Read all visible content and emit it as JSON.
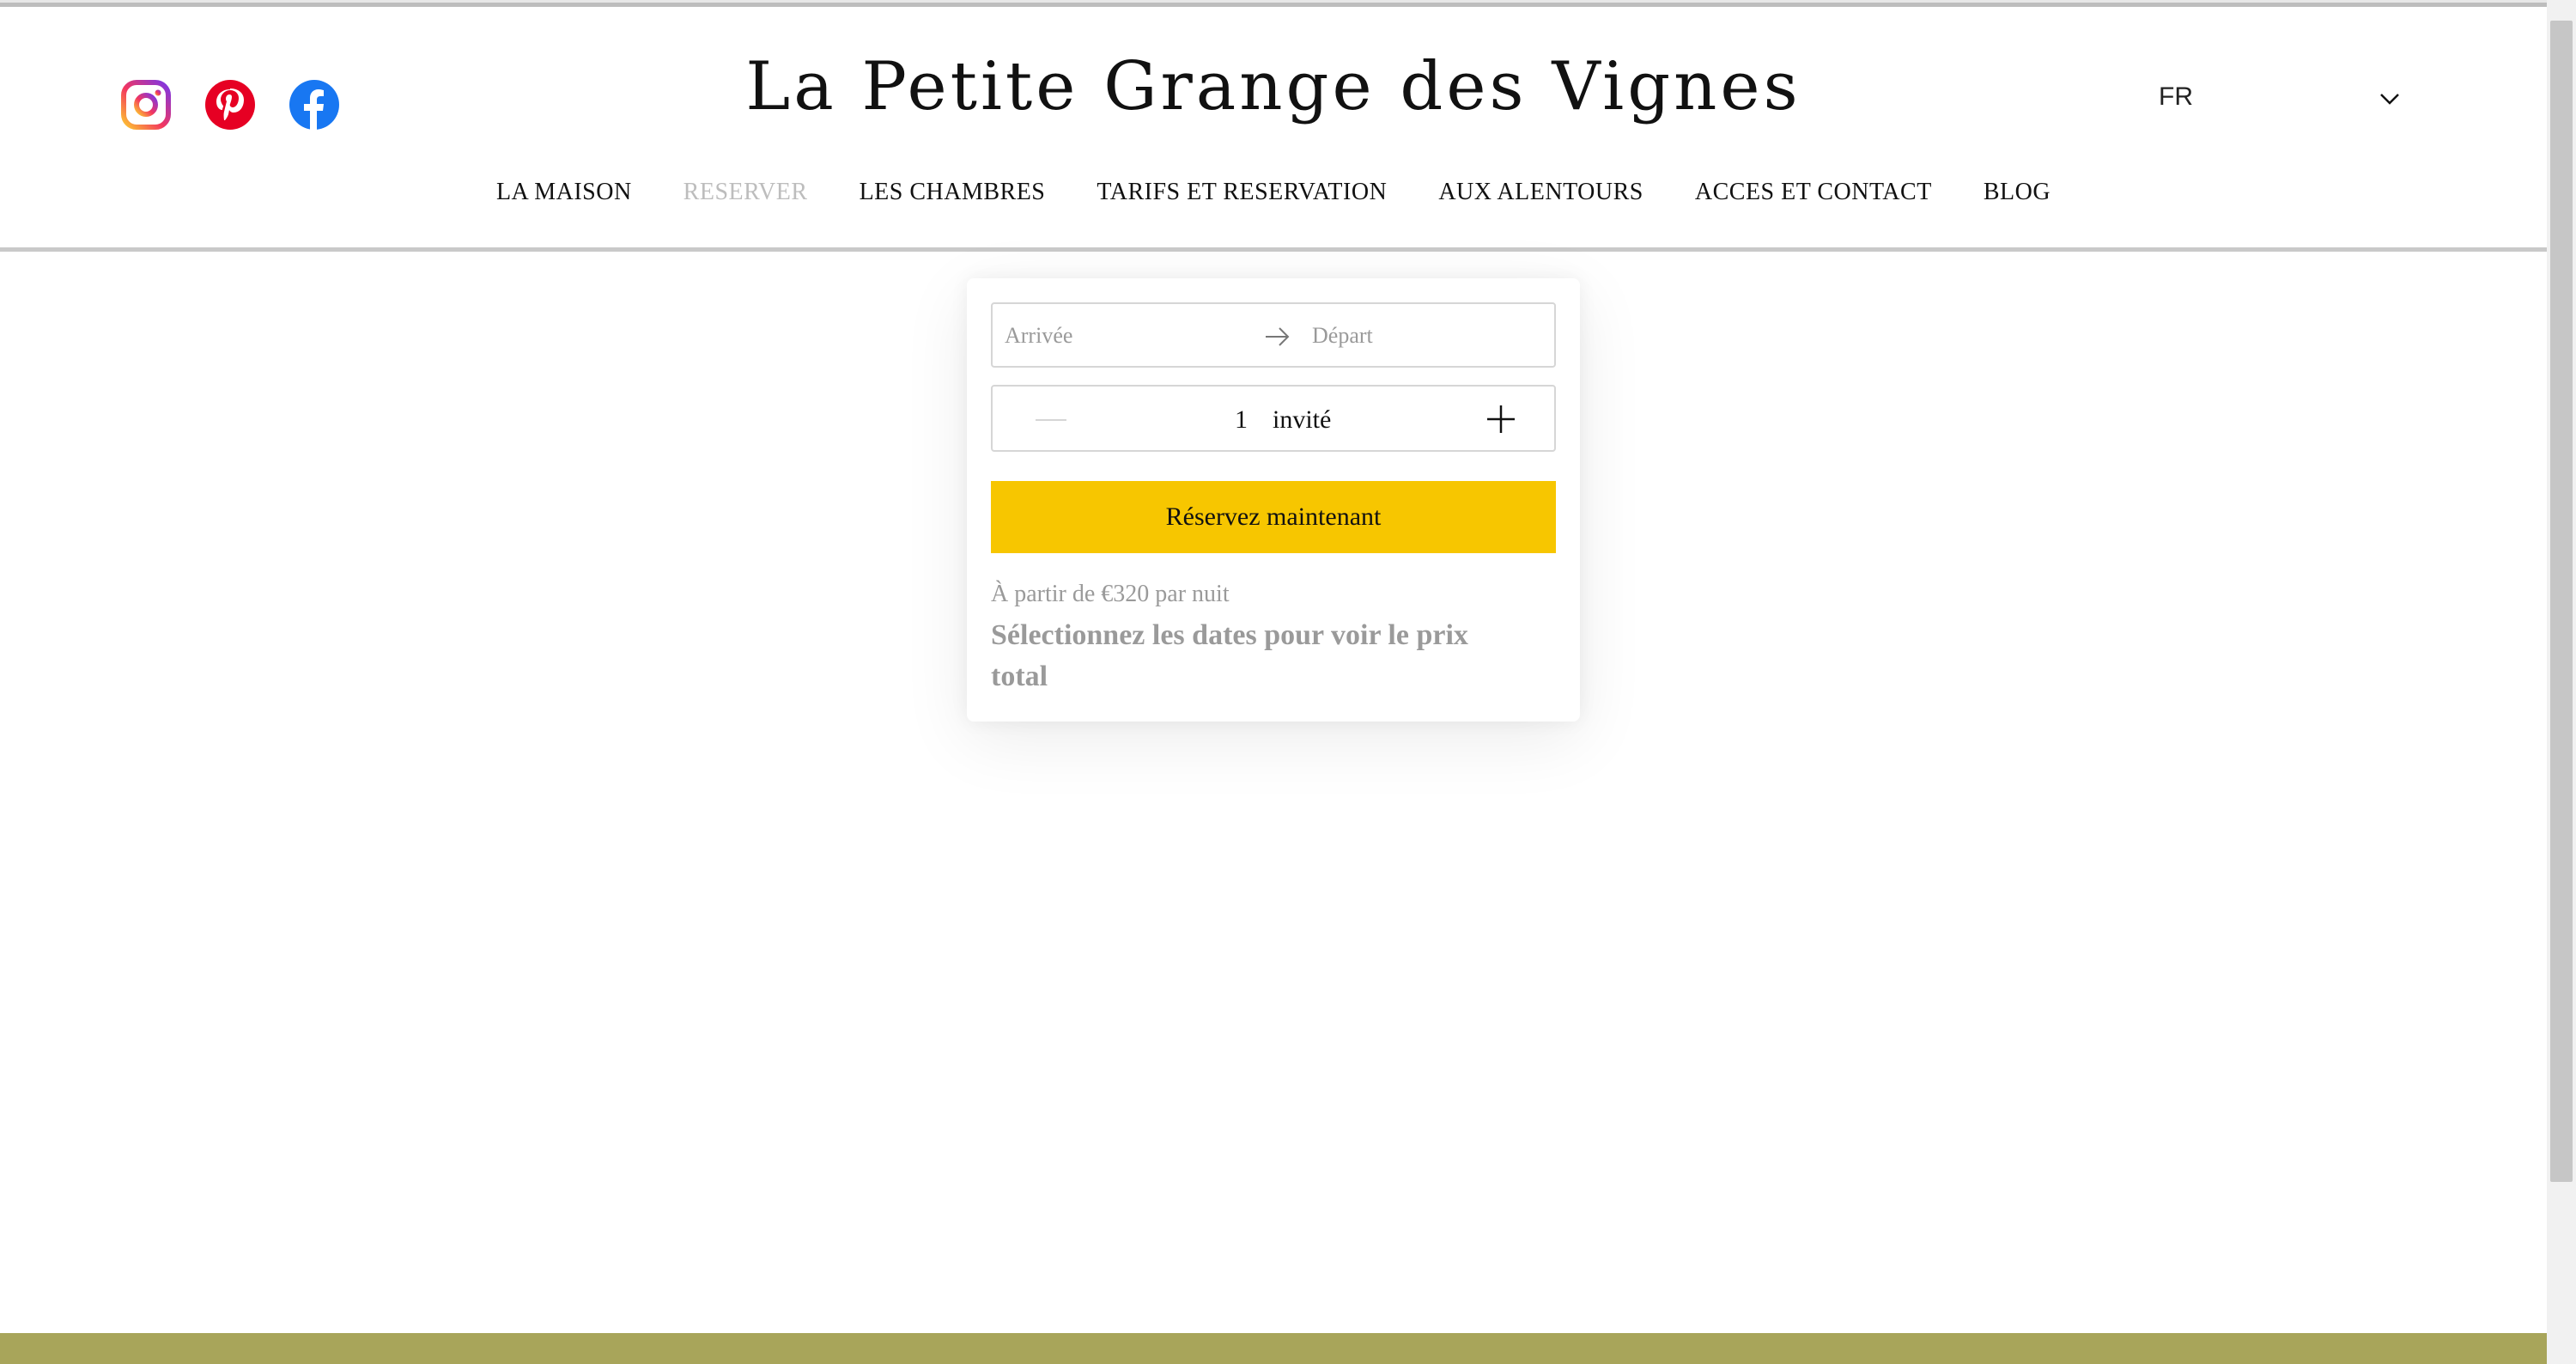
{
  "header": {
    "title": "La Petite Grange des Vignes",
    "language": "FR"
  },
  "social": [
    {
      "name": "instagram-icon"
    },
    {
      "name": "pinterest-icon"
    },
    {
      "name": "facebook-icon"
    }
  ],
  "nav": {
    "items": [
      {
        "label": "LA MAISON",
        "active": false
      },
      {
        "label": "RESERVER",
        "active": true
      },
      {
        "label": "LES CHAMBRES",
        "active": false
      },
      {
        "label": "TARIFS ET RESERVATION",
        "active": false
      },
      {
        "label": "AUX ALENTOURS",
        "active": false
      },
      {
        "label": "ACCES ET CONTACT",
        "active": false
      },
      {
        "label": "BLOG",
        "active": false
      }
    ]
  },
  "booking": {
    "arrival_placeholder": "Arrivée",
    "departure_placeholder": "Départ",
    "guests_count": "1",
    "guests_label": "invité",
    "book_button": "Réservez maintenant",
    "price_from": "À partir de €320 par nuit",
    "price_total_note": "Sélectionnez les dates pour voir le prix total"
  },
  "colors": {
    "accent": "#f7c600",
    "footer": "#a8a55a",
    "active_nav": "#bdbdbd"
  }
}
